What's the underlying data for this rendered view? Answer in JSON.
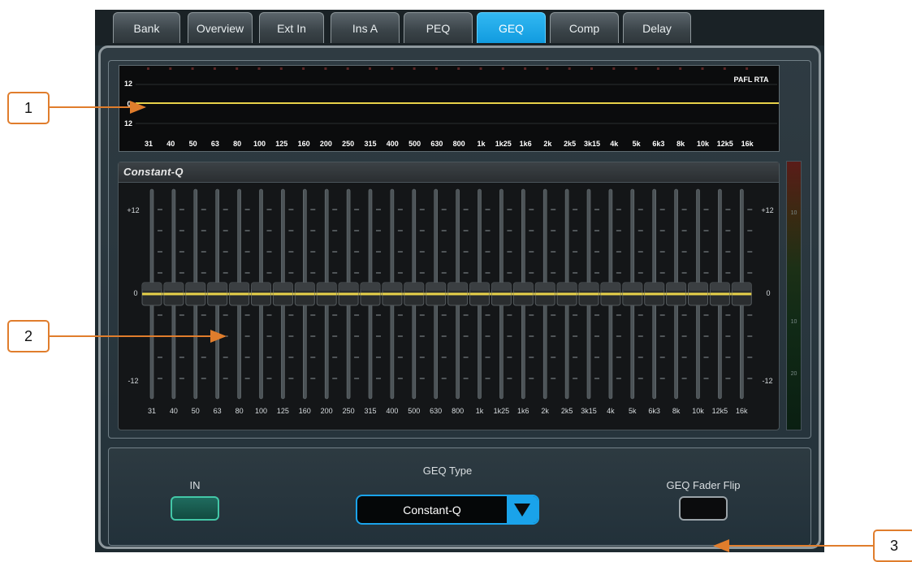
{
  "tabs": [
    {
      "label": "Bank"
    },
    {
      "label": "Overview"
    },
    {
      "label": "Ext In"
    },
    {
      "label": "Ins A"
    },
    {
      "label": "PEQ"
    },
    {
      "label": "GEQ",
      "active": true
    },
    {
      "label": "Comp"
    },
    {
      "label": "Delay"
    }
  ],
  "rta": {
    "title": "PAFL RTA",
    "scale_top": "12",
    "scale_mid": "0",
    "scale_bottom": "12"
  },
  "geq": {
    "title": "Constant-Q",
    "scale_top": "+12",
    "scale_mid": "0",
    "scale_bottom": "-12",
    "bands": [
      "31",
      "40",
      "50",
      "63",
      "80",
      "100",
      "125",
      "160",
      "200",
      "250",
      "315",
      "400",
      "500",
      "630",
      "800",
      "1k",
      "1k25",
      "1k6",
      "2k",
      "2k5",
      "3k15",
      "4k",
      "5k",
      "6k3",
      "8k",
      "10k",
      "12k5",
      "16k"
    ],
    "gains_db": [
      0,
      0,
      0,
      0,
      0,
      0,
      0,
      0,
      0,
      0,
      0,
      0,
      0,
      0,
      0,
      0,
      0,
      0,
      0,
      0,
      0,
      0,
      0,
      0,
      0,
      0,
      0,
      0
    ]
  },
  "meter": {
    "labels": [
      "10",
      "10",
      "20"
    ]
  },
  "controls": {
    "in_label": "IN",
    "geq_type_label": "GEQ Type",
    "geq_type_value": "Constant-Q",
    "flip_label": "GEQ Fader Flip"
  },
  "callouts": [
    "1",
    "2",
    "3"
  ],
  "colors": {
    "accent_blue": "#1aa3ea",
    "curve_yellow": "#e8d24a",
    "callout_orange": "#e07d2c",
    "in_green": "#43c7a7"
  }
}
